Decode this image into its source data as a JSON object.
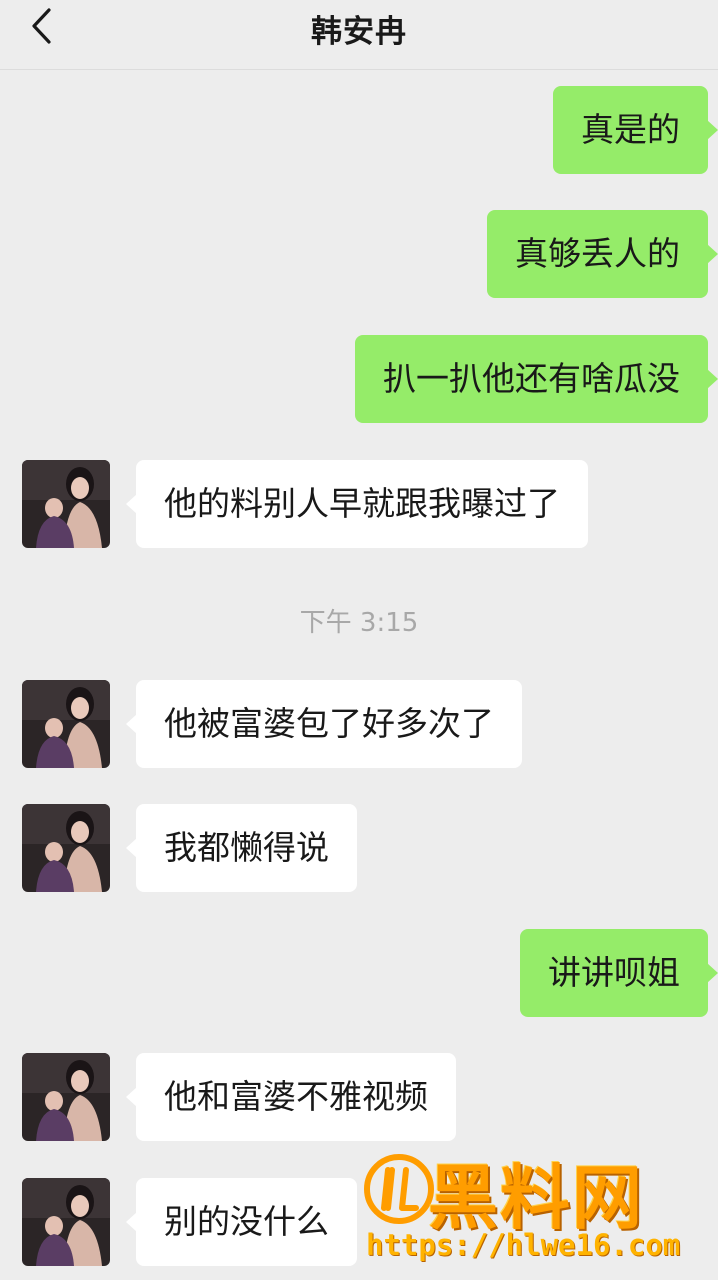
{
  "header": {
    "title": "韩安冉"
  },
  "messages": [
    {
      "side": "sent",
      "text": "真是的"
    },
    {
      "side": "sent",
      "text": "真够丢人的"
    },
    {
      "side": "sent",
      "text": "扒一扒他还有啥瓜没"
    },
    {
      "side": "received",
      "text": "他的料别人早就跟我曝过了"
    },
    {
      "side": "received",
      "text": "他被富婆包了好多次了"
    },
    {
      "side": "received",
      "text": "我都懒得说"
    },
    {
      "side": "sent",
      "text": "讲讲呗姐"
    },
    {
      "side": "received",
      "text": "他和富婆不雅视频"
    },
    {
      "side": "received",
      "text": "别的没什么"
    }
  ],
  "timestamp": "下午 3:15",
  "watermark": {
    "title": "黑料网",
    "url": "https://hlwe16.com"
  },
  "colors": {
    "sent_bubble": "#95ec69",
    "received_bubble": "#ffffff",
    "background": "#ededed",
    "watermark": "#ff9d00"
  },
  "icons": {
    "back": "chevron-left-icon",
    "avatar": "contact-avatar"
  }
}
